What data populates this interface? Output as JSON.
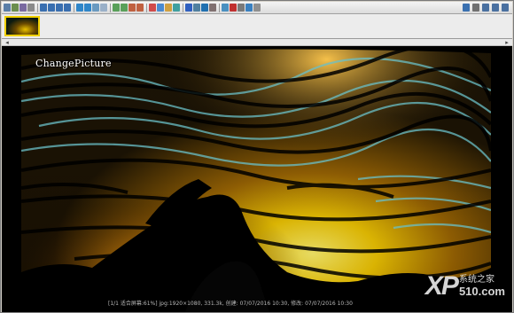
{
  "toolbar": {
    "left_icons": [
      {
        "name": "open-icon",
        "color": "#5a7ea8"
      },
      {
        "name": "browse-icon",
        "color": "#6b8e4e"
      },
      {
        "name": "save-icon",
        "color": "#7a6aa0"
      },
      {
        "name": "print-icon",
        "color": "#8a8a8a"
      },
      {
        "name": "first-icon",
        "color": "#3a6fb0"
      },
      {
        "name": "prev-icon",
        "color": "#3a6fb0"
      },
      {
        "name": "next-icon",
        "color": "#3a6fb0"
      },
      {
        "name": "last-icon",
        "color": "#3a6fb0"
      },
      {
        "name": "zoom-in-icon",
        "color": "#2f86c9"
      },
      {
        "name": "zoom-out-icon",
        "color": "#2f86c9"
      },
      {
        "name": "fit-icon",
        "color": "#6a9ac0"
      },
      {
        "name": "fullscreen-icon",
        "color": "#9ab0c8"
      },
      {
        "name": "rotate-left-icon",
        "color": "#5aa05a"
      },
      {
        "name": "rotate-right-icon",
        "color": "#5aa05a"
      },
      {
        "name": "undo-icon",
        "color": "#c06040"
      },
      {
        "name": "redo-icon",
        "color": "#c06040"
      },
      {
        "name": "color-icon",
        "color": "#d04a4a"
      },
      {
        "name": "crop-icon",
        "color": "#4a8ad0"
      },
      {
        "name": "resize-icon",
        "color": "#d0a040"
      },
      {
        "name": "effects-icon",
        "color": "#40a0a0"
      },
      {
        "name": "info-icon",
        "color": "#3060c0"
      },
      {
        "name": "histogram-icon",
        "color": "#5080a0"
      },
      {
        "name": "slideshow-icon",
        "color": "#2070b0"
      },
      {
        "name": "tools-icon",
        "color": "#807070"
      },
      {
        "name": "email-icon",
        "color": "#4a90c0"
      },
      {
        "name": "delete-icon",
        "color": "#c03030"
      },
      {
        "name": "settings-icon",
        "color": "#7a7a7a"
      },
      {
        "name": "help-icon",
        "color": "#3a80c0"
      },
      {
        "name": "about-icon",
        "color": "#909090"
      }
    ],
    "right_icons": [
      {
        "name": "download-icon",
        "color": "#3a70b0"
      },
      {
        "name": "properties-icon",
        "color": "#707070"
      },
      {
        "name": "minimize-icon",
        "color": "#4a70a0"
      },
      {
        "name": "window-icon",
        "color": "#4a70a0"
      },
      {
        "name": "exit-icon",
        "color": "#4a70a0"
      }
    ]
  },
  "scrollbar": {
    "left_arrow": "◂",
    "right_arrow": "▸"
  },
  "viewer": {
    "overlay_title": "ChangePicture",
    "status_line": "[1/1 适合屏幕:61%] jpg:1920×1080, 331.3k, 创建: 07/07/2016 10:30, 修改: 07/07/2016 10:30"
  },
  "watermark": {
    "xp": "XP",
    "cn": "系统之家",
    "num": "510.com"
  }
}
